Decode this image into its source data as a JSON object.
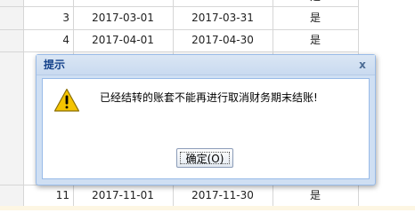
{
  "table": {
    "top_partial": {
      "flag": "是"
    },
    "rows": [
      {
        "index": "3",
        "start": "2017-03-01",
        "end": "2017-03-31",
        "flag": "是"
      },
      {
        "index": "4",
        "start": "2017-04-01",
        "end": "2017-04-30",
        "flag": "是"
      },
      {
        "index": "11",
        "start": "2017-11-01",
        "end": "2017-11-30",
        "flag": "是"
      }
    ]
  },
  "dialog": {
    "title": "提示",
    "close_glyph": "x",
    "message": "已经结转的账套不能再进行取消财务期末结账!",
    "ok_label": "确定(O)",
    "icon": "warning-icon"
  },
  "colors": {
    "dialog_title": "#15428b",
    "dialog_border": "#99bbe8",
    "warning_yellow": "#f5c400"
  }
}
